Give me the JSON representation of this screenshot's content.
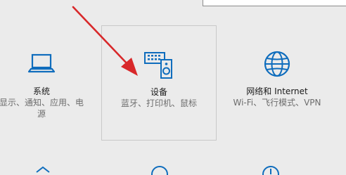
{
  "colors": {
    "background": "#ebebeb",
    "icon_blue": "#0f6dbd",
    "annotation_red": "#d8282a",
    "title_text": "#1a1a1a",
    "desc_text": "#6d6d6d"
  },
  "tiles": [
    {
      "icon": "laptop-icon",
      "title": "系统",
      "desc_lines": [
        "显示、通知、应用、电",
        "源"
      ]
    },
    {
      "icon": "devices-icon",
      "title": "设备",
      "desc_lines": [
        "蓝牙、打印机、鼠标"
      ],
      "selected": true
    },
    {
      "icon": "globe-icon",
      "title": "网络和 Internet",
      "desc_lines": [
        "Wi-Fi、飞行模式、VPN"
      ]
    }
  ],
  "bottom_row_icons": [
    "personalization-icon",
    "accounts-icon",
    "time-language-icon"
  ]
}
